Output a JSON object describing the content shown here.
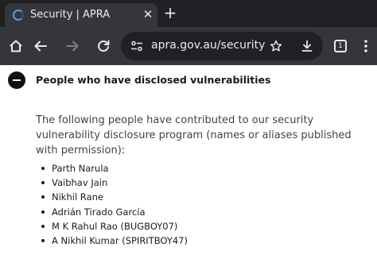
{
  "browser": {
    "tab": {
      "title": "Security | APRA",
      "favicon": "apra-favicon-icon"
    },
    "url": "apra.gov.au/security",
    "colors": {
      "frame": "#202124",
      "toolbar": "#35363a",
      "text": "#e8eaed"
    },
    "tab_count": "1"
  },
  "section": {
    "heading": "People who have disclosed vulnerabilities",
    "intro": "The following people have contributed to our security vulnerability disclosure program (names or aliases published with permission):",
    "people": [
      "Parth Narula",
      "Vaibhav Jain",
      "Nikhil Rane",
      "Adrián Tirado García",
      "M K Rahul Rao (BUGBOY07)",
      "A Nikhil Kumar (SPIRITBOY47)"
    ]
  }
}
